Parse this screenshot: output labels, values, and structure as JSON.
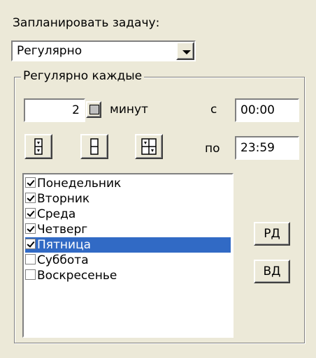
{
  "schedule": {
    "label": "Запланировать задачу:",
    "selected": "Регулярно"
  },
  "group": {
    "legend": "Регулярно каждые",
    "interval_value": "2",
    "interval_unit": "минут",
    "from_label": "с",
    "from_value": "00:00",
    "to_label": "по",
    "to_value": "23:59"
  },
  "days": [
    {
      "label": "Понедельник",
      "checked": true,
      "selected": false
    },
    {
      "label": "Вторник",
      "checked": true,
      "selected": false
    },
    {
      "label": "Среда",
      "checked": true,
      "selected": false
    },
    {
      "label": "Четверг",
      "checked": true,
      "selected": false
    },
    {
      "label": "Пятница",
      "checked": true,
      "selected": true
    },
    {
      "label": "Суббота",
      "checked": false,
      "selected": false
    },
    {
      "label": "Воскресенье",
      "checked": false,
      "selected": false
    }
  ],
  "buttons": {
    "workdays": "РД",
    "weekend": "ВД"
  },
  "icons": {
    "calc": "calculator-icon",
    "split_down": "split-down-icon",
    "split_plain": "split-icon",
    "split_grid": "split-grid-icon"
  },
  "colors": {
    "selection": "#316ac5",
    "face": "#ece9d8"
  }
}
